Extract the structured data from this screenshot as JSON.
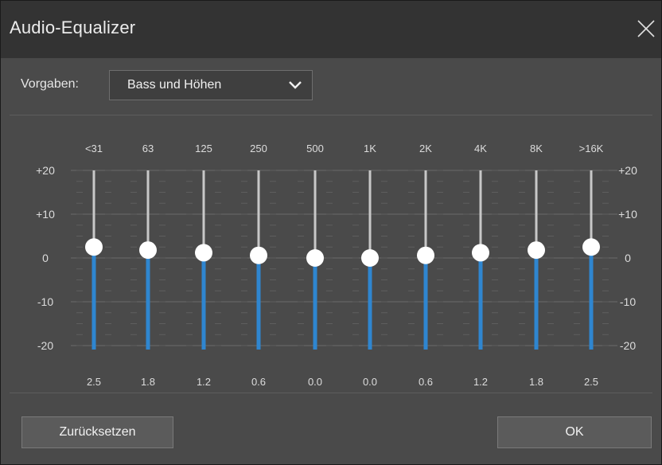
{
  "window": {
    "title": "Audio-Equalizer",
    "close_icon": "close-icon"
  },
  "preset": {
    "label": "Vorgaben:",
    "selected": "Bass und Höhen"
  },
  "equalizer": {
    "scale_left": [
      "+20",
      "+10",
      "0",
      "-10",
      "-20"
    ],
    "scale_right": [
      "+20",
      "+10",
      "0",
      "-10",
      "-20"
    ],
    "range": [
      -20,
      20
    ],
    "bands": [
      {
        "label": "<31",
        "value": 2.5,
        "value_text": "2.5"
      },
      {
        "label": "63",
        "value": 1.8,
        "value_text": "1.8"
      },
      {
        "label": "125",
        "value": 1.2,
        "value_text": "1.2"
      },
      {
        "label": "250",
        "value": 0.6,
        "value_text": "0.6"
      },
      {
        "label": "500",
        "value": 0.0,
        "value_text": "0.0"
      },
      {
        "label": "1K",
        "value": 0.0,
        "value_text": "0.0"
      },
      {
        "label": "2K",
        "value": 0.6,
        "value_text": "0.6"
      },
      {
        "label": "4K",
        "value": 1.2,
        "value_text": "1.2"
      },
      {
        "label": "8K",
        "value": 1.8,
        "value_text": "1.8"
      },
      {
        "label": ">16K",
        "value": 2.5,
        "value_text": "2.5"
      }
    ],
    "colors": {
      "fill": "#2f86d0",
      "track": "#c8c8c8",
      "knob": "#ffffff"
    }
  },
  "buttons": {
    "reset": "Zurücksetzen",
    "ok": "OK"
  }
}
